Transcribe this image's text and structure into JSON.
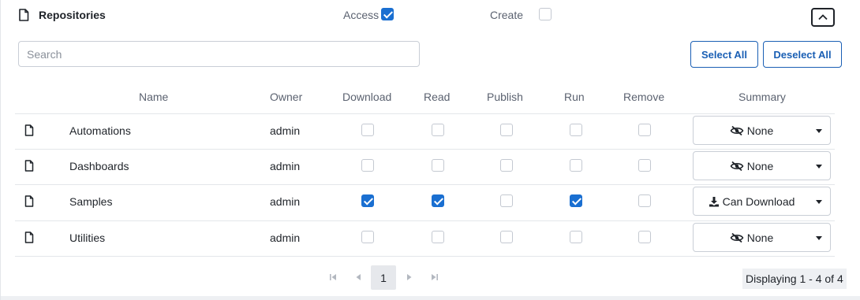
{
  "header": {
    "title": "Repositories",
    "access_label": "Access",
    "access_checked": true,
    "create_label": "Create",
    "create_checked": false,
    "collapse_icon": "chevron-up-icon"
  },
  "search": {
    "placeholder": "Search",
    "value": ""
  },
  "buttons": {
    "select_all": "Select All",
    "deselect_all": "Deselect All"
  },
  "columns": {
    "name": "Name",
    "owner": "Owner",
    "download": "Download",
    "read": "Read",
    "publish": "Publish",
    "run": "Run",
    "remove": "Remove",
    "summary": "Summary"
  },
  "rows": [
    {
      "name": "Automations",
      "owner": "admin",
      "download": false,
      "read": false,
      "publish": false,
      "run": false,
      "remove": false,
      "summary": "None",
      "summary_icon": "eye-slash-icon"
    },
    {
      "name": "Dashboards",
      "owner": "admin",
      "download": false,
      "read": false,
      "publish": false,
      "run": false,
      "remove": false,
      "summary": "None",
      "summary_icon": "eye-slash-icon"
    },
    {
      "name": "Samples",
      "owner": "admin",
      "download": true,
      "read": true,
      "publish": false,
      "run": true,
      "remove": false,
      "summary": "Can Download",
      "summary_icon": "download-icon"
    },
    {
      "name": "Utilities",
      "owner": "admin",
      "download": false,
      "read": false,
      "publish": false,
      "run": false,
      "remove": false,
      "summary": "None",
      "summary_icon": "eye-slash-icon"
    }
  ],
  "pagination": {
    "current_page": "1",
    "status": "Displaying 1 - 4 of 4"
  },
  "colors": {
    "accent": "#1a6fd1",
    "button_border": "#1a5fb4"
  }
}
